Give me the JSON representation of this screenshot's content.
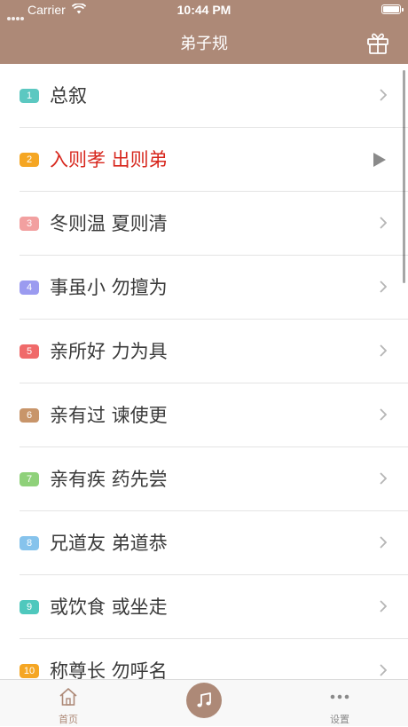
{
  "status_bar": {
    "carrier": "Carrier",
    "time": "10:44 PM",
    "wifi_icon": "wifi-icon",
    "battery_icon": "battery-icon"
  },
  "nav": {
    "title": "弟子规",
    "gift_icon": "gift-icon"
  },
  "colors": {
    "header": "#ad8977",
    "active_text": "#d7261c"
  },
  "chapters": [
    {
      "num": "1",
      "title": "总叙",
      "color": "#5cc8c1",
      "active": false
    },
    {
      "num": "2",
      "title": "入则孝 出则弟",
      "color": "#f5a623",
      "active": true
    },
    {
      "num": "3",
      "title": "冬则温 夏则清",
      "color": "#f2a0a0",
      "active": false
    },
    {
      "num": "4",
      "title": "事虽小 勿擅为",
      "color": "#9b9bf0",
      "active": false
    },
    {
      "num": "5",
      "title": "亲所好 力为具",
      "color": "#f06a6a",
      "active": false
    },
    {
      "num": "6",
      "title": "亲有过 谏使更",
      "color": "#c8956a",
      "active": false
    },
    {
      "num": "7",
      "title": "亲有疾 药先尝",
      "color": "#8fd17a",
      "active": false
    },
    {
      "num": "8",
      "title": "兄道友 弟道恭",
      "color": "#86c3ec",
      "active": false
    },
    {
      "num": "9",
      "title": "或饮食 或坐走",
      "color": "#4fc8bd",
      "active": false
    },
    {
      "num": "10",
      "title": "称尊长 勿呼名",
      "color": "#f5a623",
      "active": false
    }
  ],
  "tabbar": {
    "home_label": "首页",
    "home_icon": "home-icon",
    "music_icon": "music-note-icon",
    "settings_label": "设置",
    "settings_icon": "more-icon"
  }
}
